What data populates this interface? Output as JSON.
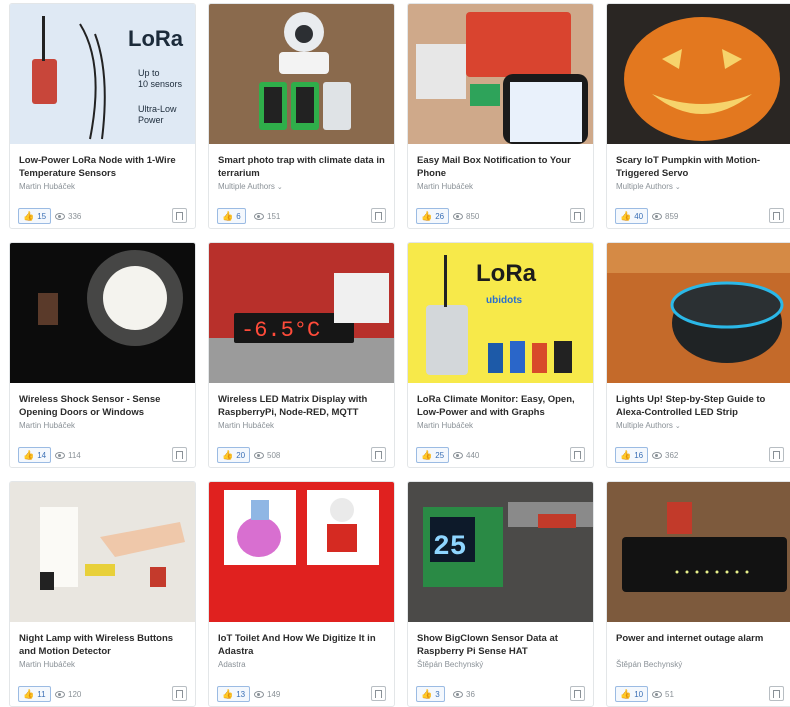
{
  "cards": [
    {
      "title": "Low-Power LoRa Node with 1-Wire Temperature Sensors",
      "author": "Martin Hubáček",
      "multi": false,
      "likes": "15",
      "views": "336",
      "thumb_text": {
        "a": "LoRa",
        "b": "Up to",
        "c": "10 sensors",
        "d": "Ultra-Low",
        "e": "Power"
      }
    },
    {
      "title": "Smart photo trap with climate data in terrarium",
      "author": "Multiple Authors",
      "multi": true,
      "likes": "6",
      "views": "151"
    },
    {
      "title": "Easy Mail Box Notification to Your Phone",
      "author": "Martin Hubáček",
      "multi": false,
      "likes": "26",
      "views": "850"
    },
    {
      "title": "Scary IoT Pumpkin with Motion-Triggered Servo",
      "author": "Multiple Authors",
      "multi": true,
      "likes": "40",
      "views": "859"
    },
    {
      "title": "Wireless Shock Sensor - Sense Opening Doors or Windows",
      "author": "Martin Hubáček",
      "multi": false,
      "likes": "14",
      "views": "114"
    },
    {
      "title": "Wireless LED Matrix Display with RaspberryPi, Node-RED, MQTT",
      "author": "Martin Hubáček",
      "multi": false,
      "likes": "20",
      "views": "508",
      "thumb_text": {
        "a": "-6.5°C"
      }
    },
    {
      "title": "LoRa Climate Monitor: Easy, Open, Low-Power and with Graphs",
      "author": "Martin Hubáček",
      "multi": false,
      "likes": "25",
      "views": "440",
      "thumb_text": {
        "a": "LoRa",
        "b": "ubidots"
      }
    },
    {
      "title": "Lights Up! Step-by-Step Guide to Alexa-Controlled LED Strip",
      "author": "Multiple Authors",
      "multi": true,
      "likes": "16",
      "views": "362"
    },
    {
      "title": "Night Lamp with Wireless Buttons and Motion Detector",
      "author": "Martin Hubáček",
      "multi": false,
      "likes": "11",
      "views": "120"
    },
    {
      "title": "IoT Toilet And How We Digitize It in Adastra",
      "author": "Adastra",
      "multi": false,
      "likes": "13",
      "views": "149"
    },
    {
      "title": "Show BigClown Sensor Data at Raspberry Pi Sense HAT",
      "author": "Štěpán Bechynský",
      "multi": false,
      "likes": "3",
      "views": "36",
      "thumb_text": {
        "a": "25"
      }
    },
    {
      "title": "Power and internet outage alarm",
      "author": "Štěpán Bechynský",
      "multi": false,
      "likes": "10",
      "views": "51"
    }
  ],
  "colors": {
    "accent": "#3a6fb5",
    "border": "#e3e6e8",
    "muted": "#8a9197"
  },
  "icons": {
    "like": "thumbs-up-icon",
    "views": "eye-icon",
    "bookmark": "bookmark-icon",
    "chevron": "chevron-down-icon"
  }
}
